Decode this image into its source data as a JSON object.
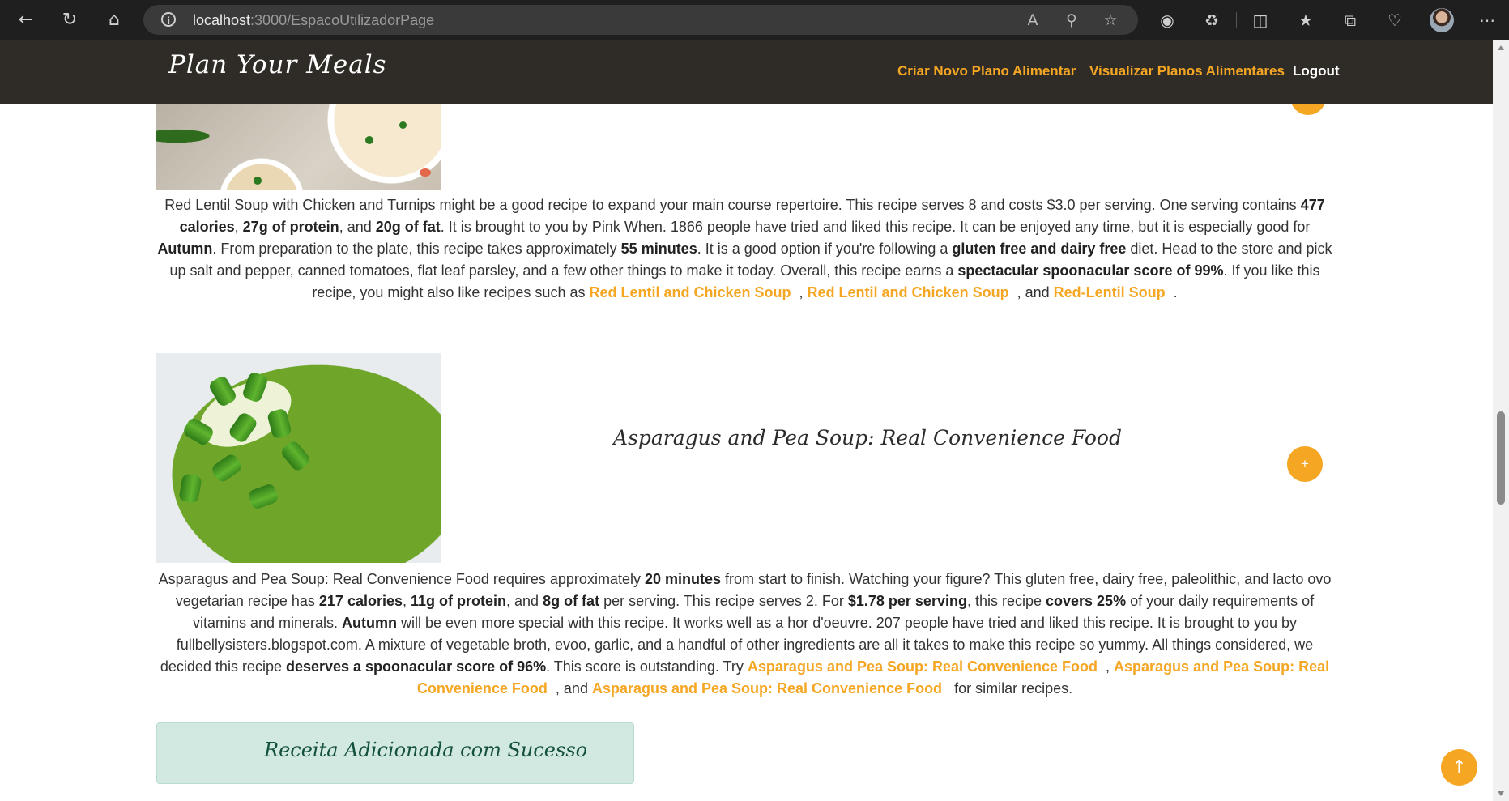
{
  "browser": {
    "url_host": "localhost",
    "url_path": ":3000/EspacoUtilizadorPage",
    "icons": {
      "back": "back-arrow-icon",
      "refresh": "refresh-icon",
      "home": "home-icon",
      "info": "info-icon",
      "read_aloud": "read-aloud-icon",
      "zoom": "zoom-out-icon",
      "favorite": "star-icon",
      "extension1": "extension-icon",
      "extensions": "puzzle-icon",
      "split": "split-screen-icon",
      "favorites": "favorites-icon",
      "collections": "collections-icon",
      "health": "browser-essentials-icon",
      "more": "more-icon"
    }
  },
  "navbar": {
    "brand": "Plan Your Meals",
    "links": [
      {
        "label": "Criar Novo Plano Alimentar"
      },
      {
        "label": "Visualizar Planos Alimentares"
      },
      {
        "label": "Logout"
      }
    ]
  },
  "recipe1": {
    "desc_parts": {
      "p1": "Red Lentil Soup with Chicken and Turnips might be a good recipe to expand your main course repertoire. This recipe serves 8 and costs $3.0 per serving. One serving contains ",
      "b1": "477 calories",
      "p2": ", ",
      "b2": "27g of protein",
      "p3": ", and ",
      "b3": "20g of fat",
      "p4": ". It is brought to you by Pink When. 1866 people have tried and liked this recipe. It can be enjoyed any time, but it is especially good for ",
      "b4": "Autumn",
      "p5": ". From preparation to the plate, this recipe takes approximately ",
      "b5": "55 minutes",
      "p6": ". It is a good option if you're following a ",
      "b6": "gluten free and dairy free",
      "p7": " diet. Head to the store and pick up salt and pepper, canned tomatoes, flat leaf parsley, and a few other things to make it today. Overall, this recipe earns a ",
      "b7": "spectacular spoonacular score of 99%",
      "p8": ". If you like this recipe, you might also like recipes such as ",
      "l1": "Red Lentil and Chicken Soup",
      "p9": ", ",
      "l2": "Red Lentil and Chicken Soup",
      "p10": ", and ",
      "l3": "Red-Lentil Soup",
      "p11": "."
    }
  },
  "recipe2": {
    "title": "Asparagus and Pea Soup: Real Convenience Food",
    "add_label": "+",
    "desc_parts": {
      "p1": "Asparagus and Pea Soup: Real Convenience Food requires approximately ",
      "b1": "20 minutes",
      "p2": " from start to finish. Watching your figure? This gluten free, dairy free, paleolithic, and lacto ovo vegetarian recipe has ",
      "b2": "217 calories",
      "p3": ", ",
      "b3": "11g of protein",
      "p4": ", and ",
      "b4": "8g of fat",
      "p5": " per serving. This recipe serves 2. For ",
      "b5": "$1.78 per serving",
      "p6": ", this recipe ",
      "b6": "covers 25%",
      "p7": " of your daily requirements of vitamins and minerals. ",
      "b7": "Autumn",
      "p8": " will be even more special with this recipe. It works well as a hor d'oeuvre. 207 people have tried and liked this recipe. It is brought to you by fullbellysisters.blogspot.com. A mixture of vegetable broth, evoo, garlic, and a handful of other ingredients are all it takes to make this recipe so yummy. All things considered, we decided this recipe ",
      "b8": "deserves a spoonacular score of 96%",
      "p9": ". This score is outstanding. Try ",
      "l1": "Asparagus and Pea Soup: Real Convenience Food",
      "p10": ", ",
      "l2": "Asparagus and Pea Soup: Real Convenience Food",
      "p11": ", and ",
      "l3": "Asparagus and Pea Soup: Real Convenience Food",
      "p12": " for similar recipes."
    }
  },
  "toast": {
    "message": "Receita Adicionada com Sucesso"
  },
  "scroll_top": {
    "label": "↑"
  },
  "colors": {
    "accent": "#f5a623",
    "navbar": "#2f2c28",
    "toast_bg": "#d2e9e1",
    "toast_text": "#14513a"
  }
}
